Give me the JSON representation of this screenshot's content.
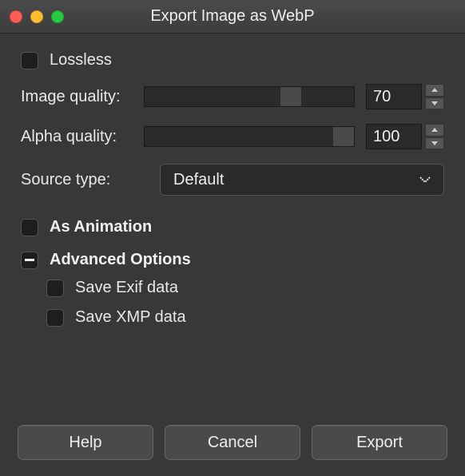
{
  "window": {
    "title": "Export Image as WebP"
  },
  "lossless": {
    "label": "Lossless",
    "checked": false
  },
  "image_quality": {
    "label": "Image quality:",
    "value": "70",
    "percent": 70
  },
  "alpha_quality": {
    "label": "Alpha quality:",
    "value": "100",
    "percent": 100
  },
  "source_type": {
    "label": "Source type:",
    "selected": "Default"
  },
  "as_animation": {
    "label": "As Animation",
    "checked": false
  },
  "advanced": {
    "label": "Advanced Options",
    "state": "mixed",
    "save_exif": {
      "label": "Save Exif data",
      "checked": false
    },
    "save_xmp": {
      "label": "Save XMP data",
      "checked": false
    }
  },
  "buttons": {
    "help": "Help",
    "cancel": "Cancel",
    "export": "Export"
  }
}
